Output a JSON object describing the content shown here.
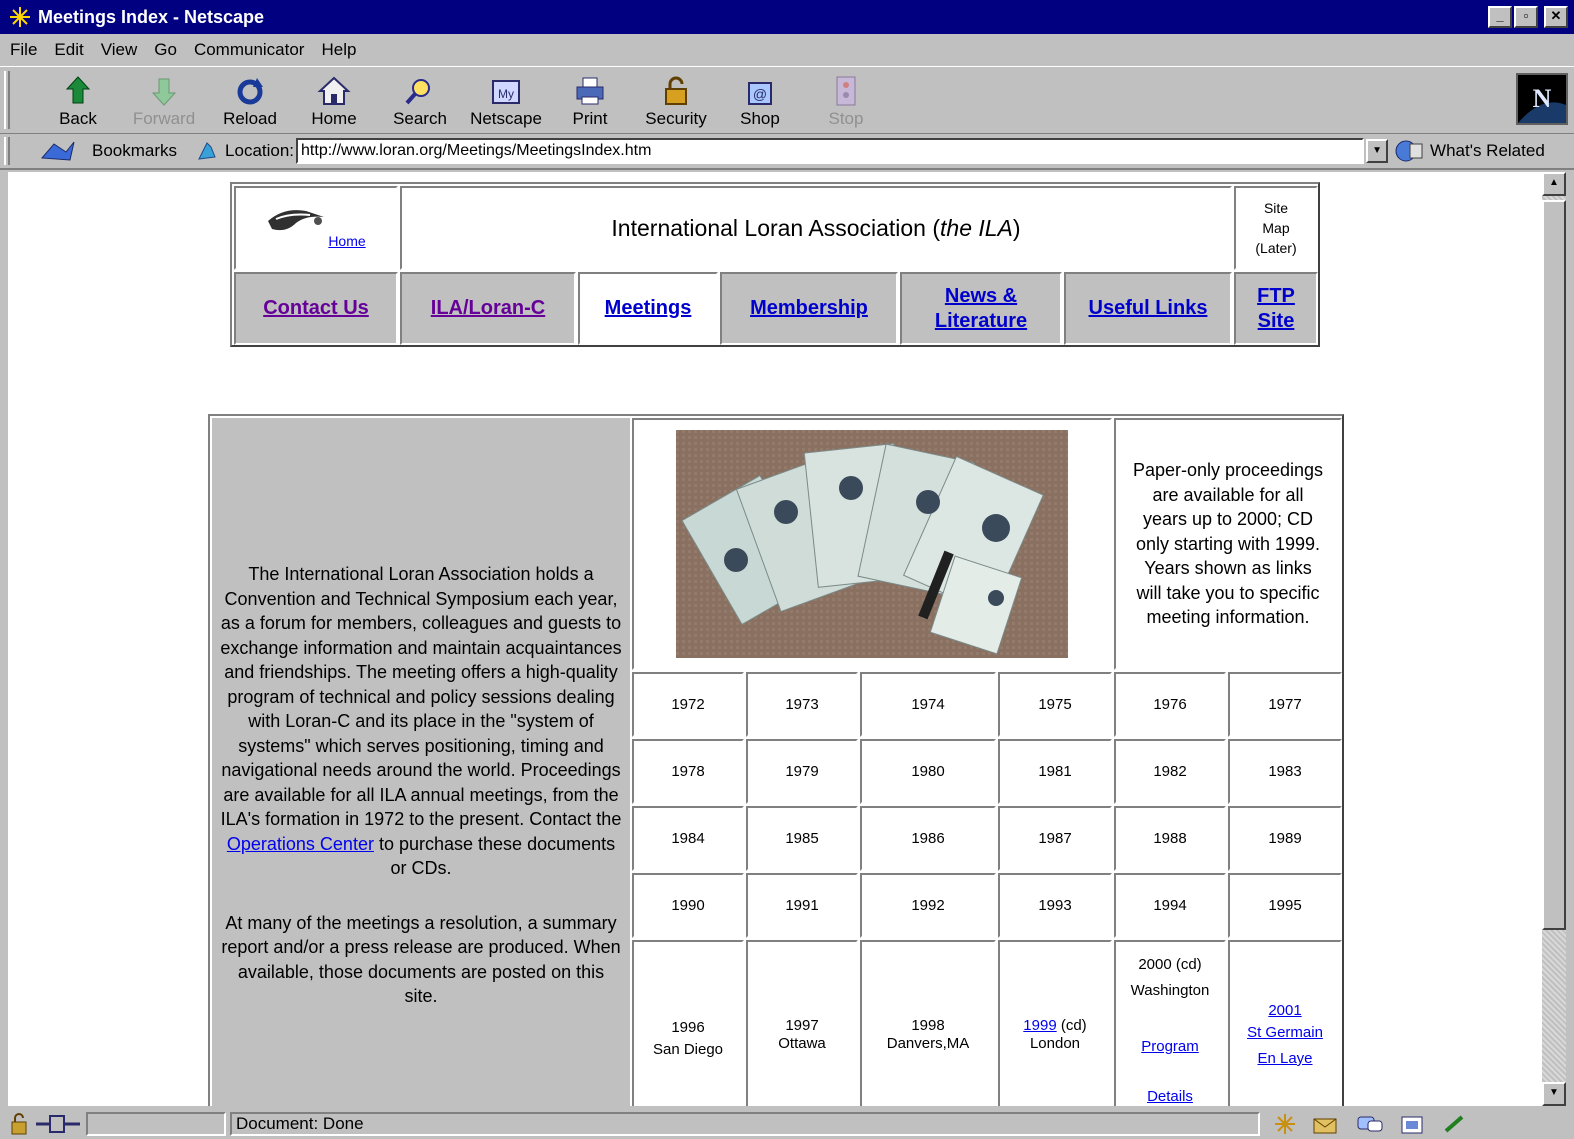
{
  "window": {
    "title": "Meetings Index - Netscape"
  },
  "menu": [
    "File",
    "Edit",
    "View",
    "Go",
    "Communicator",
    "Help"
  ],
  "toolbar": {
    "back": "Back",
    "forward": "Forward",
    "reload": "Reload",
    "home": "Home",
    "search": "Search",
    "netscape": "Netscape",
    "print": "Print",
    "security": "Security",
    "shop": "Shop",
    "stop": "Stop"
  },
  "location": {
    "bookmarks": "Bookmarks",
    "label": "Location:",
    "url": "http://www.loran.org/Meetings/MeetingsIndex.htm",
    "related": "What's Related"
  },
  "header": {
    "home_link": "Home",
    "title_prefix": "International Loran Association (",
    "title_italic": "the ILA",
    "title_suffix": ")",
    "sitemap_1": "Site",
    "sitemap_2": "Map",
    "sitemap_3": "(Later)"
  },
  "nav": [
    "Contact Us",
    "ILA/Loran-C",
    "Meetings",
    "Membership",
    "News &",
    "Literature",
    "Useful Links",
    "FTP",
    "Site"
  ],
  "description": {
    "p1_before_link": "The International Loran Association holds a Convention and Technical Symposium each year, as a forum for members, colleagues and guests to exchange information and maintain acquaintances and friendships. The meeting offers a high-quality program of technical and policy sessions dealing with Loran-C and its place in the \"system of systems\" which serves positioning, timing and navigational needs around the world. Proceedings are available for all ILA annual meetings, from the ILA's formation in 1972 to the present. Contact the",
    "p1_link": "Operations Center",
    "p1_after_link": "to purchase these documents or CDs.",
    "p2": "At many of the meetings a resolution, a summary report and/or a press release are produced. When available, those documents are posted on this site."
  },
  "note": "Paper-only proceedings are available for all years up to 2000; CD only starting with 1999. Years shown as links will take you to specific meeting information.",
  "years": {
    "r1": [
      "1972",
      "1973",
      "1974",
      "1975",
      "1976",
      "1977"
    ],
    "r2": [
      "1978",
      "1979",
      "1980",
      "1981",
      "1982",
      "1983"
    ],
    "r3": [
      "1984",
      "1985",
      "1986",
      "1987",
      "1988",
      "1989"
    ],
    "r4": [
      "1990",
      "1991",
      "1992",
      "1993",
      "1994",
      "1995"
    ]
  },
  "recent": {
    "y1996": "1996",
    "c1996": "San Diego",
    "y1997": "1997",
    "c1997": "Ottawa",
    "y1998": "1998",
    "c1998": "Danvers,MA",
    "y1999": "1999",
    "cd1999": "(cd)",
    "c1999": "London",
    "y2000": "2000 (cd)",
    "c2000": "Washington",
    "program": "Program",
    "details": "Details",
    "y2001": "2001",
    "c2001a": "St Germain",
    "c2001b": "En Laye"
  },
  "status": {
    "text": "Document: Done"
  }
}
